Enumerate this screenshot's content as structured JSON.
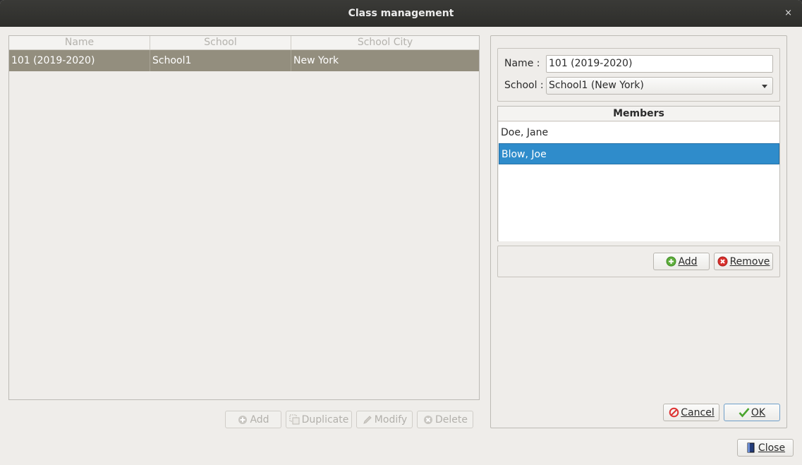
{
  "window": {
    "title": "Class management",
    "close_glyph": "×"
  },
  "table": {
    "columns": [
      "Name",
      "School",
      "School City"
    ],
    "rows": [
      {
        "name": "101 (2019-2020)",
        "school": "School1",
        "city": "New York"
      }
    ],
    "selection_color": "#938e7e"
  },
  "table_buttons": {
    "add": "Add",
    "duplicate": "Duplicate",
    "modify": "Modify",
    "delete": "Delete"
  },
  "form": {
    "name_label": "Name :",
    "name_value": "101 (2019-2020)",
    "school_label": "School :",
    "school_value": "School1 (New York)"
  },
  "members": {
    "header": "Members",
    "items": [
      "Doe, Jane",
      "Blow, Joe"
    ],
    "selected_index": 1,
    "add_label": "Add",
    "remove_label": "Remove",
    "selection_color": "#2f8ccb"
  },
  "dialog_buttons": {
    "cancel": "Cancel",
    "ok": "OK"
  },
  "footer": {
    "close_label": "Close"
  },
  "icons": {
    "add": "add-circle-icon",
    "duplicate": "duplicate-icon",
    "modify": "pencil-icon",
    "delete": "delete-circle-icon",
    "remove": "remove-circle-icon",
    "cancel": "cancel-icon",
    "ok": "checkmark-icon",
    "close": "door-icon"
  }
}
